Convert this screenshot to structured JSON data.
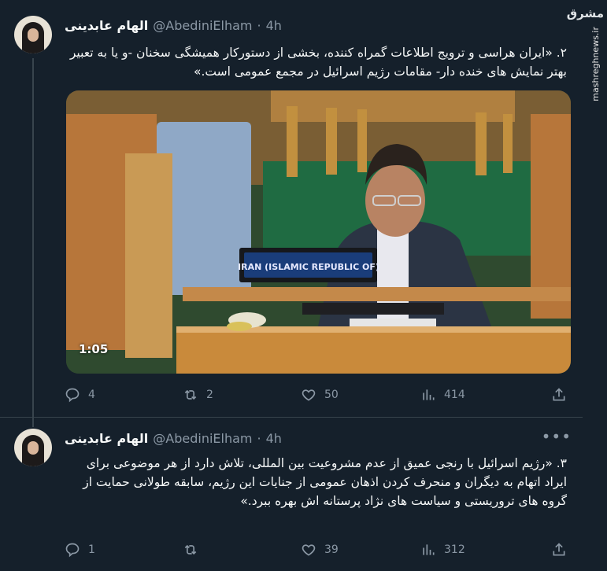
{
  "watermark": {
    "logo": "مشرق",
    "url": "mashreghnews.ir"
  },
  "tweets": [
    {
      "name": "الهام عابدینی",
      "handle": "@AbediniElham",
      "time": "4h",
      "text": "۲. «ایران هراسی و ترویج اطلاعات گمراه کننده، بخشی از دستورکار همیشگی سخنان -و یا به تعبیر بهتر نمایش های خنده دار- مقامات رژیم اسرائیل در مجمع عمومی است.»",
      "video": {
        "duration": "1:05",
        "nameplate": "IRAN (ISLAMIC REPUBLIC OF)"
      },
      "replies": "4",
      "retweets": "2",
      "likes": "50",
      "views": "414"
    },
    {
      "name": "الهام عابدینی",
      "handle": "@AbediniElham",
      "time": "4h",
      "text": "۳. «رژیم اسرائیل با رنجی عمیق از عدم مشروعیت بین المللی، تلاش دارد از هر موضوعی برای ایراد اتهام به دیگران و منحرف کردن اذهان عمومی از جنایات این رژیم، سابقه طولانی حمایت از گروه های تروریستی و سیاست های نژاد پرستانه اش بهره ببرد.»",
      "replies": "1",
      "retweets": "",
      "likes": "39",
      "views": "312"
    }
  ]
}
